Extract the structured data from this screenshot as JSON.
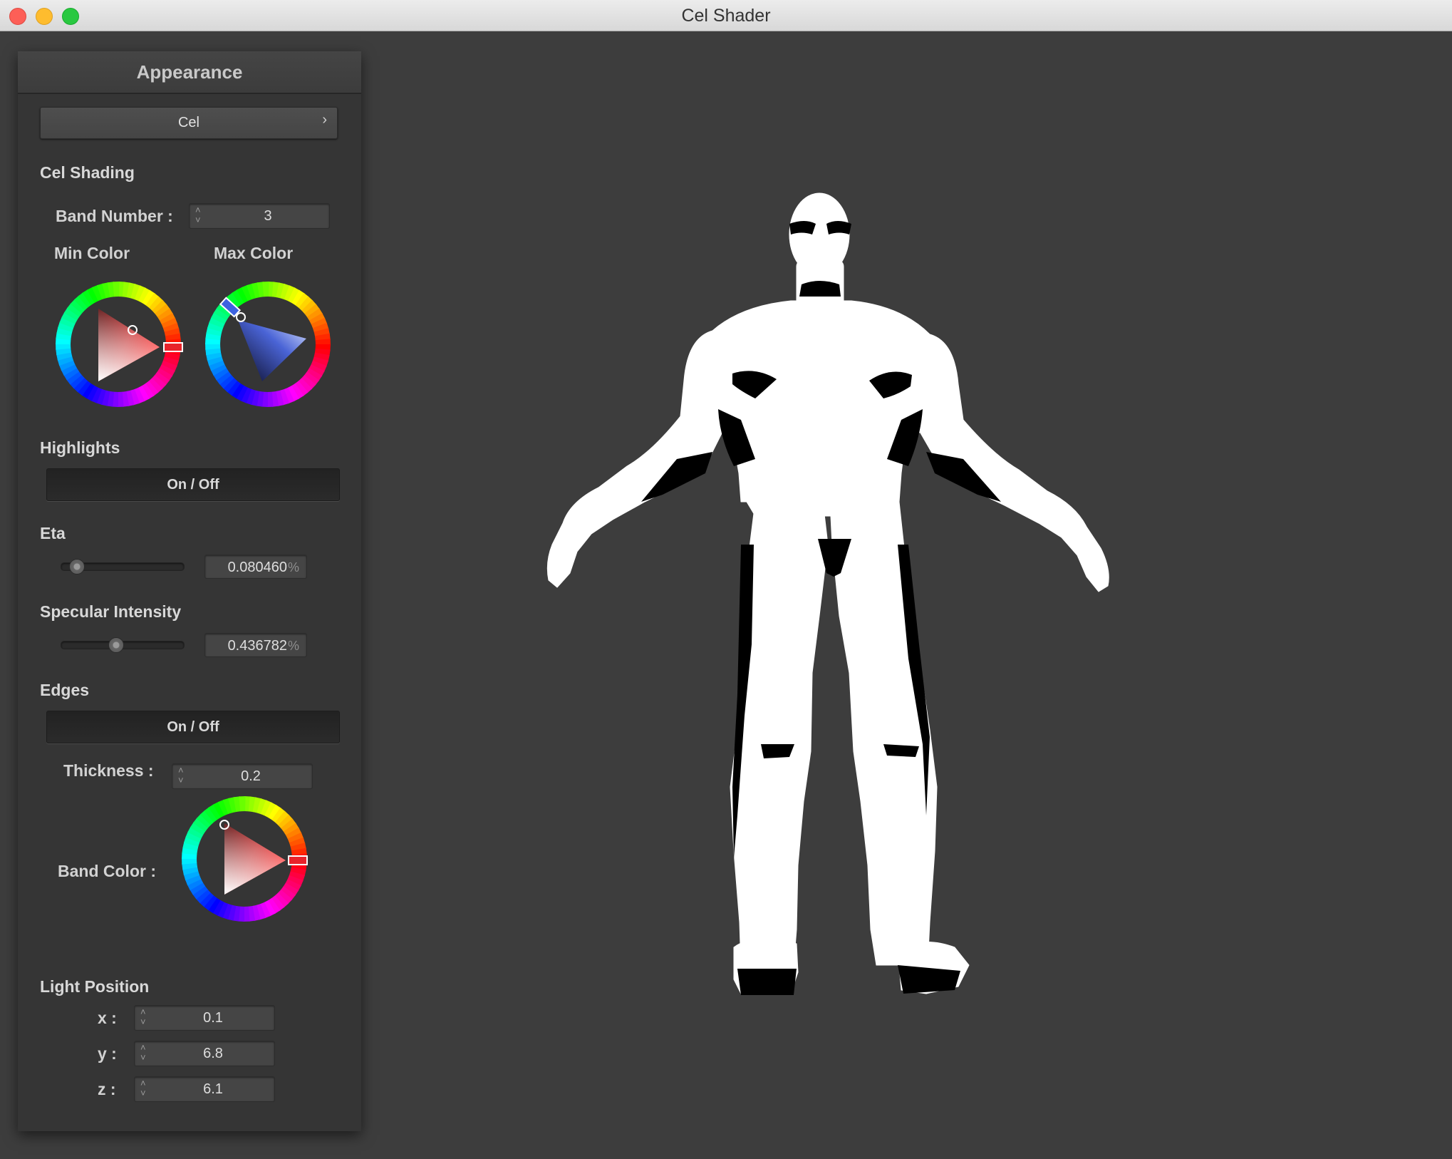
{
  "window": {
    "title": "Cel Shader"
  },
  "panel": {
    "header": "Appearance",
    "shader_dropdown": {
      "value": "Cel",
      "chevron": "›"
    },
    "cel_shading": {
      "title": "Cel Shading",
      "band_number_label": "Band Number :",
      "band_number_value": "3",
      "min_color_label": "Min Color",
      "max_color_label": "Max Color",
      "min_color": "#e8232b",
      "max_color": "#3d63e0"
    },
    "highlights": {
      "title": "Highlights",
      "toggle_label": "On / Off",
      "eta_label": "Eta",
      "eta_value": "0.080460",
      "eta_unit": "%",
      "eta_fraction": 0.08,
      "specular_label": "Specular Intensity",
      "specular_value": "0.436782",
      "specular_unit": "%",
      "specular_fraction": 0.44
    },
    "edges": {
      "title": "Edges",
      "toggle_label": "On / Off",
      "thickness_label": "Thickness :",
      "thickness_value": "0.2",
      "band_color_label": "Band Color :",
      "band_color": "#e8232b"
    },
    "light_position": {
      "title": "Light Position",
      "x_label": "x :",
      "x_value": "0.1",
      "y_label": "y :",
      "y_value": "6.8",
      "z_label": "z :",
      "z_value": "6.1"
    }
  },
  "spin_arrows": "˄\n˅",
  "icons": {
    "close": "close-window-icon",
    "minimize": "minimize-window-icon",
    "zoom": "zoom-window-icon",
    "spin": "stepper-arrows-icon",
    "chevron": "chevron-right-icon"
  }
}
